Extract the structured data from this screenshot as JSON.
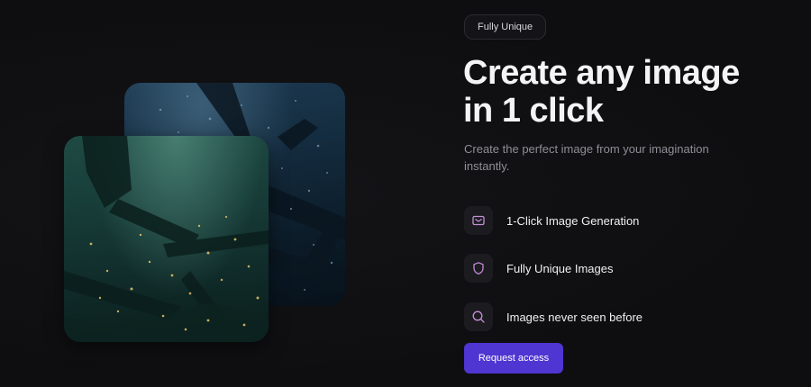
{
  "badge": {
    "label": "Fully Unique"
  },
  "hero": {
    "headline_line1": "Create any image",
    "headline_line2": "in 1 click",
    "subtext_line1": "Create the perfect image from your imagination",
    "subtext_line2": "instantly."
  },
  "features": [
    {
      "icon": "mail-icon",
      "label": "1-Click Image Generation"
    },
    {
      "icon": "shield-icon",
      "label": "Fully Unique Images"
    },
    {
      "icon": "search-icon",
      "label": "Images never seen before"
    }
  ],
  "cta": {
    "label": "Request access"
  },
  "colors": {
    "background": "#0f0f11",
    "accent": "#4f35d2",
    "icon_tint": "#c58fd6",
    "muted_text": "#8e8e96"
  },
  "images": [
    {
      "name": "underwater-shipwreck-blue-image"
    },
    {
      "name": "underwater-shipwreck-green-image"
    }
  ]
}
